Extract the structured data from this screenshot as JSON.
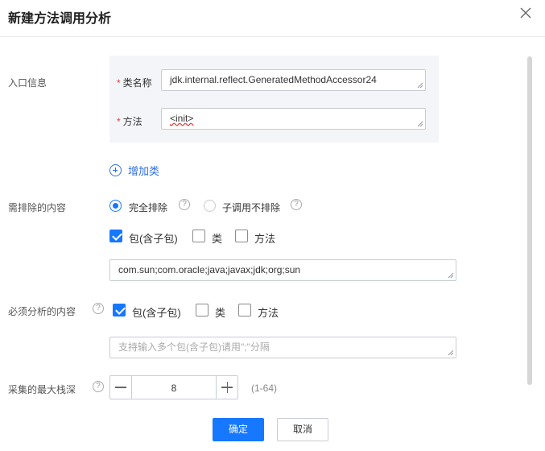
{
  "dialog": {
    "title": "新建方法调用分析"
  },
  "entry": {
    "label": "入口信息",
    "class_label": "类名称",
    "class_value": "jdk.internal.reflect.GeneratedMethodAccessor24",
    "method_label": "方法",
    "method_value": "<init>",
    "required_mark": "*",
    "add_class": "增加类"
  },
  "exclude": {
    "label": "需排除的内容",
    "mode_options": [
      "完全排除",
      "子调用不排除"
    ],
    "mode_selected": "完全排除",
    "help": "?",
    "checks": [
      {
        "label": "包(含子包)",
        "checked": true
      },
      {
        "label": "类",
        "checked": false
      },
      {
        "label": "方法",
        "checked": false
      }
    ],
    "value": "com.sun;com.oracle;java;javax;jdk;org;sun"
  },
  "required_analysis": {
    "label": "必须分析的内容",
    "help": "?",
    "checks": [
      {
        "label": "包(含子包)",
        "checked": true
      },
      {
        "label": "类",
        "checked": false
      },
      {
        "label": "方法",
        "checked": false
      }
    ],
    "placeholder": "支持输入多个包(含子包)请用\";\"分隔"
  },
  "stack_depth": {
    "label": "采集的最大栈深",
    "help": "?",
    "value": "8",
    "range": "(1-64)"
  },
  "footer": {
    "ok_label": "确定",
    "cancel_label": "取消"
  },
  "colors": {
    "accent": "#1677ff",
    "link": "#2f6fe6",
    "required": "#e53935",
    "panel_bg": "#f4f5f8"
  }
}
